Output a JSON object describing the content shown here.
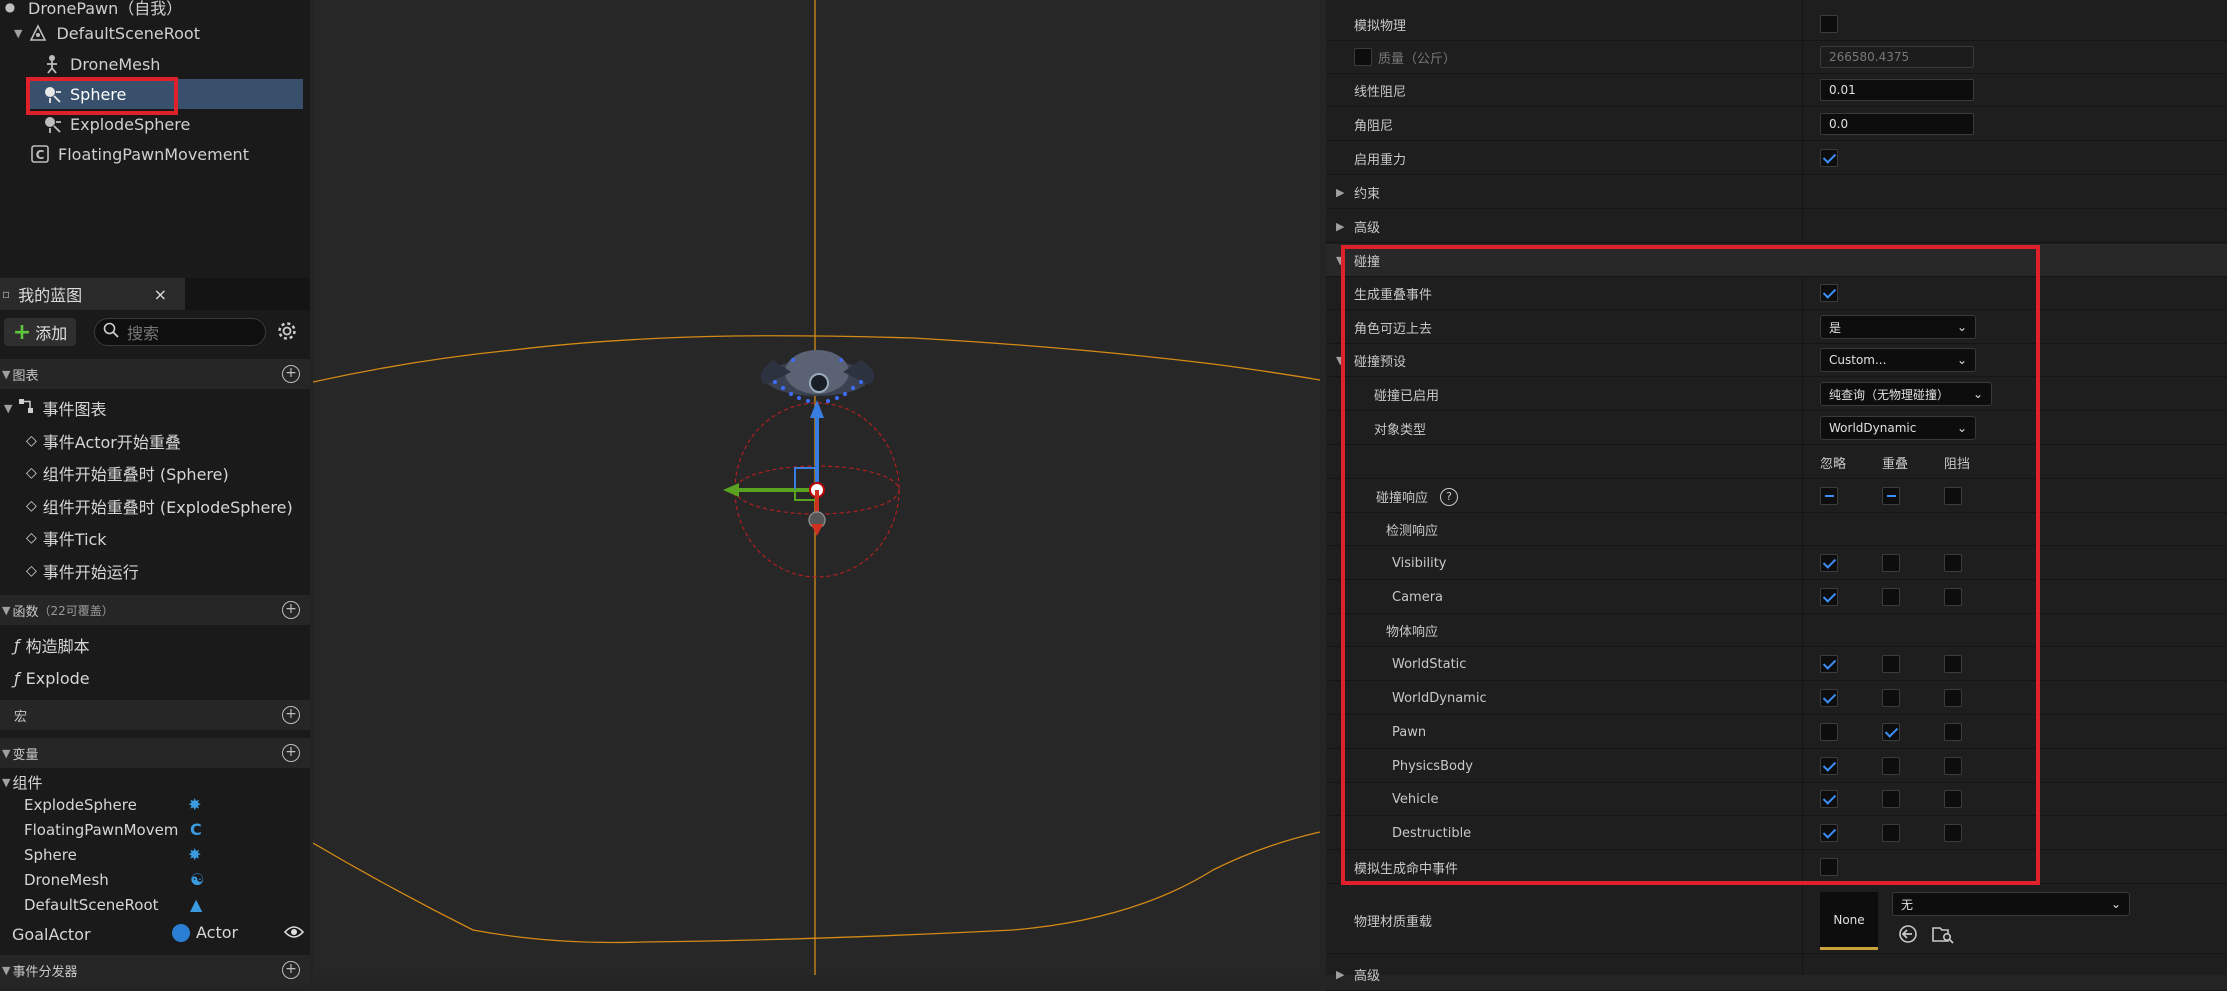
{
  "outliner": {
    "root": "DronePawn（自我）",
    "scene_root": "DefaultSceneRoot",
    "items": [
      "DroneMesh",
      "Sphere",
      "ExplodeSphere"
    ],
    "movement": "FloatingPawnMovement"
  },
  "my_blueprint": {
    "tab": "我的蓝图",
    "add_label": "添加",
    "search_placeholder": "搜索",
    "graphs_header": "图表",
    "event_graph": "事件图表",
    "events": [
      "事件Actor开始重叠",
      "组件开始重叠时 (Sphere)",
      "组件开始重叠时 (ExplodeSphere)",
      "事件Tick",
      "事件开始运行"
    ],
    "functions_header": "函数",
    "functions_count": "（22可覆盖）",
    "functions": [
      "构造脚本",
      "Explode"
    ],
    "macros_header": "宏",
    "variables_header": "变量",
    "components_header": "组件",
    "components": [
      "ExplodeSphere",
      "FloatingPawnMovem",
      "Sphere",
      "DroneMesh",
      "DefaultSceneRoot"
    ],
    "goal_actor": "GoalActor",
    "goal_actor_type": "Actor",
    "dispatchers_header": "事件分发器"
  },
  "details": {
    "simulate_physics": "模拟物理",
    "mass": "质量（公斤）",
    "mass_value": "266580.4375",
    "linear_damping": "线性阻尼",
    "linear_damping_value": "0.01",
    "angular_damping": "角阻尼",
    "angular_damping_value": "0.0",
    "enable_gravity": "启用重力",
    "constraints": "约束",
    "advanced": "高级",
    "collision": "碰撞",
    "gen_overlap": "生成重叠事件",
    "can_step_up": "角色可迈上去",
    "can_step_up_value": "是",
    "collision_presets": "碰撞预设",
    "collision_presets_value": "Custom...",
    "collision_enabled": "碰撞已启用",
    "collision_enabled_value": "纯查询（无物理碰撞）",
    "object_type": "对象类型",
    "object_type_value": "WorldDynamic",
    "col_ignore": "忽略",
    "col_overlap": "重叠",
    "col_block": "阻挡",
    "collision_responses": "碰撞响应",
    "trace_responses": "检测响应",
    "object_responses": "物体响应",
    "channels": [
      "Visibility",
      "Camera",
      "WorldStatic",
      "WorldDynamic",
      "Pawn",
      "PhysicsBody",
      "Vehicle",
      "Destructible"
    ],
    "sim_hit_events": "模拟生成命中事件",
    "phys_material": "物理材质重载",
    "phys_material_thumb": "None",
    "phys_material_value": "无",
    "advanced_bottom": "高级"
  }
}
